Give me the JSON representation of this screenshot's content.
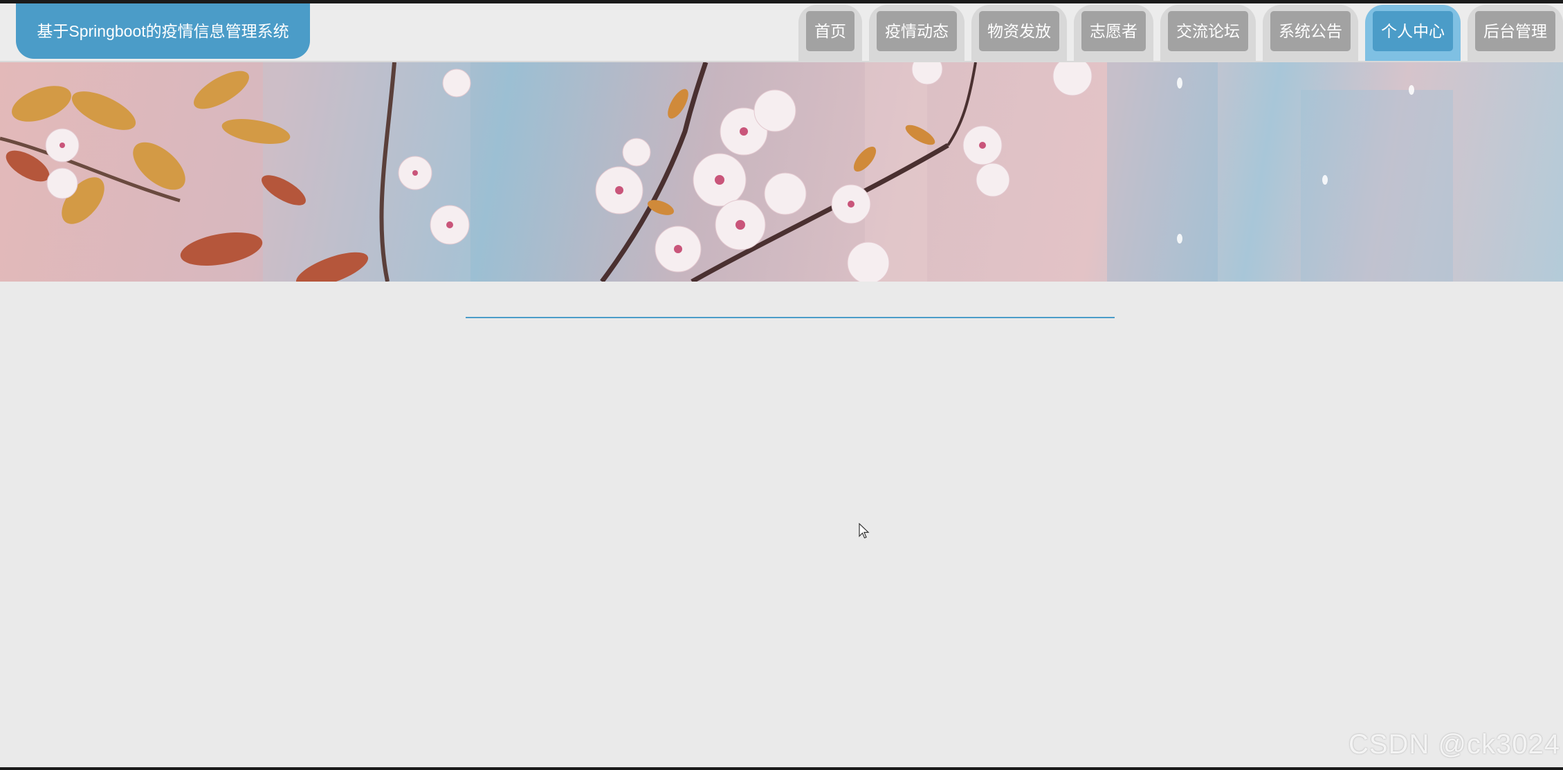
{
  "header": {
    "brand_title": "基于Springboot的疫情信息管理系统",
    "nav": [
      {
        "label": "首页",
        "active": false
      },
      {
        "label": "疫情动态",
        "active": false
      },
      {
        "label": "物资发放",
        "active": false
      },
      {
        "label": "志愿者",
        "active": false
      },
      {
        "label": "交流论坛",
        "active": false
      },
      {
        "label": "系统公告",
        "active": false
      },
      {
        "label": "个人中心",
        "active": true
      },
      {
        "label": "后台管理",
        "active": false
      }
    ]
  },
  "banner": {
    "image": "cherry-blossom-banner"
  },
  "watermark": "CSDN @ck3024",
  "colors": {
    "accent": "#4b9cc8",
    "accent_light": "#7fc0e3",
    "nav_inactive": "#a2a2a2",
    "background": "#eaeaea"
  }
}
